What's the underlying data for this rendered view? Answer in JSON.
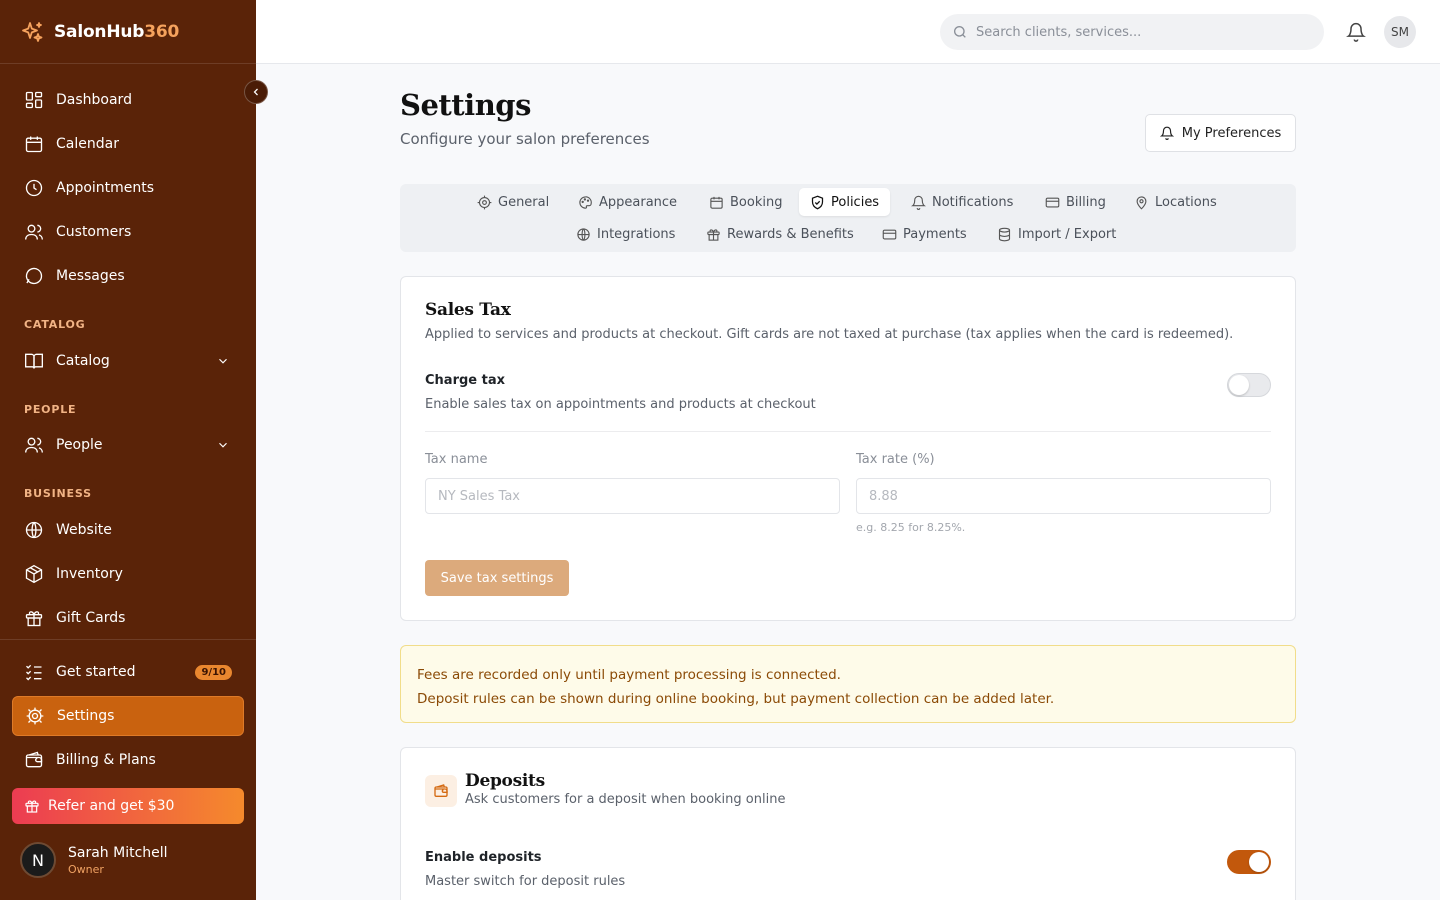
{
  "brand": {
    "name": "SalonHub",
    "accent": "360"
  },
  "colors": {
    "sidebar_bg": "#5a2308",
    "accent": "#c9620f",
    "toggle_on": "#c2580c"
  },
  "sidebar": {
    "main": [
      {
        "label": "Dashboard",
        "icon": "dashboard-icon"
      },
      {
        "label": "Calendar",
        "icon": "calendar-icon"
      },
      {
        "label": "Appointments",
        "icon": "clock-icon"
      },
      {
        "label": "Customers",
        "icon": "users-icon"
      },
      {
        "label": "Messages",
        "icon": "message-icon"
      }
    ],
    "sections": {
      "catalog": {
        "title": "CATALOG",
        "item": "Catalog"
      },
      "people": {
        "title": "PEOPLE",
        "item": "People"
      },
      "business": {
        "title": "BUSINESS",
        "items": [
          "Website",
          "Inventory",
          "Gift Cards"
        ]
      }
    },
    "get_started": {
      "label": "Get started",
      "progress": "9/10"
    },
    "settings": "Settings",
    "billing": "Billing & Plans",
    "refer": "Refer and get $30",
    "user": {
      "initial": "N",
      "name": "Sarah Mitchell",
      "role": "Owner"
    }
  },
  "topbar": {
    "search_placeholder": "Search clients, services...",
    "avatar_initials": "SM"
  },
  "page": {
    "title": "Settings",
    "subtitle": "Configure your salon preferences",
    "preferences_button": "My Preferences"
  },
  "tabs": [
    {
      "label": "General",
      "icon": "gear-icon"
    },
    {
      "label": "Appearance",
      "icon": "palette-icon"
    },
    {
      "label": "Booking",
      "icon": "calendar-icon"
    },
    {
      "label": "Policies",
      "icon": "shield-icon",
      "active": true
    },
    {
      "label": "Notifications",
      "icon": "bell-icon"
    },
    {
      "label": "Billing",
      "icon": "credit-card-icon"
    },
    {
      "label": "Locations",
      "icon": "map-pin-icon"
    },
    {
      "label": "Integrations",
      "icon": "globe-icon"
    },
    {
      "label": "Rewards & Benefits",
      "icon": "gift-icon"
    },
    {
      "label": "Payments",
      "icon": "credit-card-icon"
    },
    {
      "label": "Import / Export",
      "icon": "database-icon"
    }
  ],
  "sales_tax": {
    "title": "Sales Tax",
    "description": "Applied to services and products at checkout. Gift cards are not taxed at purchase (tax applies when the card is redeemed).",
    "charge_label": "Charge tax",
    "charge_desc": "Enable sales tax on appointments and products at checkout",
    "charge_enabled": false,
    "tax_name_label": "Tax name",
    "tax_name_placeholder": "NY Sales Tax",
    "tax_rate_label": "Tax rate (%)",
    "tax_rate_placeholder": "8.88",
    "tax_rate_hint": "e.g. 8.25 for 8.25%.",
    "save_button": "Save tax settings"
  },
  "notice": {
    "line1": "Fees are recorded only until payment processing is connected.",
    "line2": "Deposit rules can be shown during online booking, but payment collection can be added later."
  },
  "deposits": {
    "title": "Deposits",
    "subtitle": "Ask customers for a deposit when booking online",
    "enable_label": "Enable deposits",
    "enable_desc": "Master switch for deposit rules",
    "enabled": true
  }
}
